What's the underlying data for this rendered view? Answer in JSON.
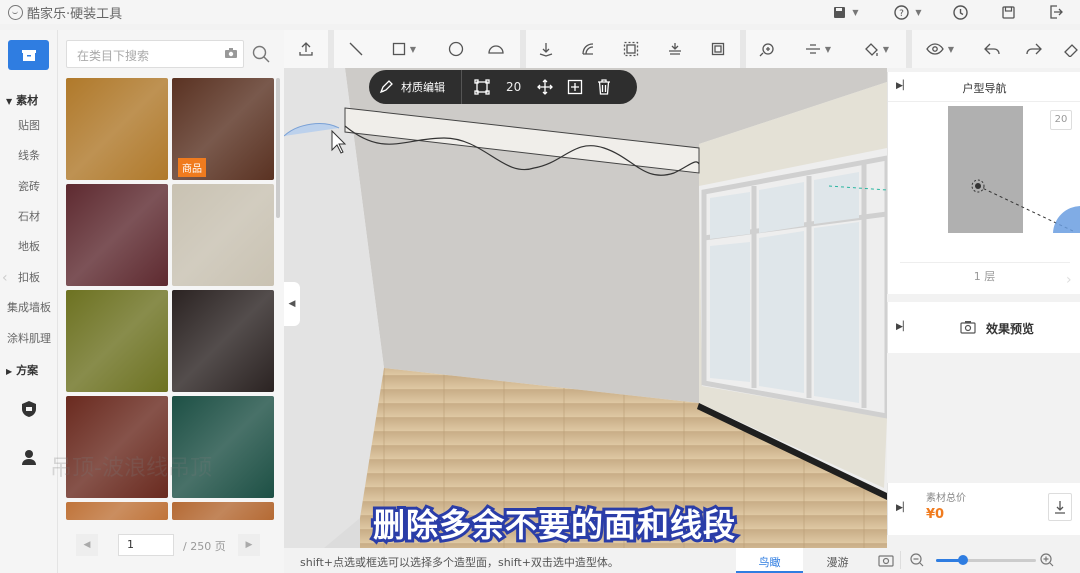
{
  "app": {
    "title": "酷家乐·硬装工具"
  },
  "search": {
    "placeholder": "在类目下搜索"
  },
  "rail": {
    "section_material": "素材",
    "items": [
      "贴图",
      "线条",
      "瓷砖",
      "石材",
      "地板",
      "扣板",
      "集成墙板",
      "涂料肌理"
    ],
    "section_plan": "方案"
  },
  "materials": [
    {
      "color": "#b0792a",
      "badge": ""
    },
    {
      "color": "#5a3222",
      "badge": "商品"
    },
    {
      "color": "#5e2a30",
      "badge": ""
    },
    {
      "color": "#c9c2b2",
      "badge": ""
    },
    {
      "color": "#6d7221",
      "badge": ""
    },
    {
      "color": "#2b2322",
      "badge": ""
    },
    {
      "color": "#6a2a1f",
      "badge": ""
    },
    {
      "color": "#1d5045",
      "badge": ""
    },
    {
      "color": "#c0743a",
      "badge": ""
    },
    {
      "color": "#b56a34",
      "badge": ""
    }
  ],
  "pager": {
    "current": "1",
    "total": "/ 250 页"
  },
  "edit_toolbar": {
    "label": "材质编辑",
    "value": "20"
  },
  "nav_panel": {
    "title": "户型导航",
    "zoom": "20",
    "floor": "1 层"
  },
  "preview_panel": {
    "label": "效果预览"
  },
  "price_panel": {
    "label": "素材总价",
    "value": "¥0"
  },
  "statusbar": {
    "hint": "shift+点选或框选可以选择多个造型面，shift+双击选中造型体。",
    "tab_bird": "鸟瞰",
    "tab_roam": "漫游",
    "zoom_fraction": 0.27
  },
  "subtitle": "删除多余不要的面和线段",
  "watermark": "吊顶-波浪线吊顶",
  "colors": {
    "accent": "#2f7de1",
    "price": "#f07b1e",
    "badge": "#f07b1e"
  }
}
